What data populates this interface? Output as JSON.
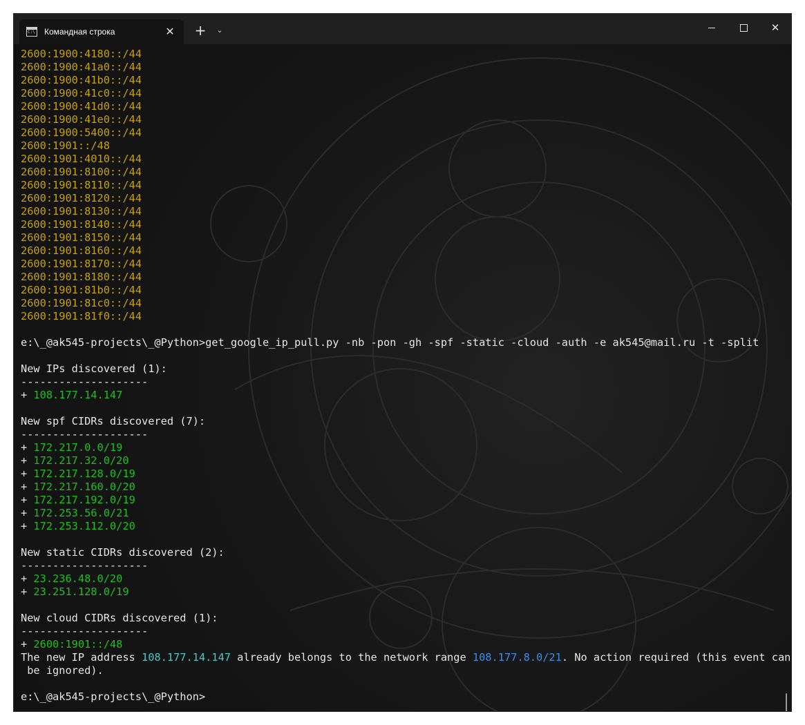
{
  "window": {
    "tab_title": "Командная строка",
    "tab_icon": "cmd-icon",
    "buttons": {
      "close_tab": "✕",
      "new_tab": "+",
      "dropdown": "⌄",
      "minimize": "minimize-icon",
      "maximize": "maximize-icon",
      "close": "✕"
    }
  },
  "colors": {
    "background": "#131313",
    "titlebar": "#202020",
    "yellow": "#c8a200",
    "green": "#19c419",
    "cyan": "#4cc7c7",
    "blue": "#3b8eea",
    "text": "#e6e6e6"
  },
  "terminal": {
    "yellow_cidrs": [
      "2600:1900:4180::/44",
      "2600:1900:41a0::/44",
      "2600:1900:41b0::/44",
      "2600:1900:41c0::/44",
      "2600:1900:41d0::/44",
      "2600:1900:41e0::/44",
      "2600:1900:5400::/44",
      "2600:1901::/48",
      "2600:1901:4010::/44",
      "2600:1901:8100::/44",
      "2600:1901:8110::/44",
      "2600:1901:8120::/44",
      "2600:1901:8130::/44",
      "2600:1901:8140::/44",
      "2600:1901:8150::/44",
      "2600:1901:8160::/44",
      "2600:1901:8170::/44",
      "2600:1901:8180::/44",
      "2600:1901:81b0::/44",
      "2600:1901:81c0::/44",
      "2600:1901:81f0::/44"
    ],
    "command": "e:\\_@ak545-projects\\_@Python>get_google_ip_pull.py -nb -pon -gh -spf -static -cloud -auth -e ak545@mail.ru -t -split",
    "separator": "--------------------",
    "plus": "+ ",
    "sections": [
      {
        "header": "New IPs discovered (1):",
        "items": [
          "108.177.14.147"
        ]
      },
      {
        "header": "New spf CIDRs discovered (7):",
        "items": [
          "172.217.0.0/19",
          "172.217.32.0/20",
          "172.217.128.0/19",
          "172.217.160.0/20",
          "172.217.192.0/19",
          "172.253.56.0/21",
          "172.253.112.0/20"
        ]
      },
      {
        "header": "New static CIDRs discovered (2):",
        "items": [
          "23.236.48.0/20",
          "23.251.128.0/19"
        ]
      },
      {
        "header": "New cloud CIDRs discovered (1):",
        "items": [
          "2600:1901::/48"
        ]
      }
    ],
    "message": {
      "part1": "The new IP address ",
      "ip": "108.177.14.147",
      "part2": " already belongs to the network range ",
      "range": "108.177.8.0/21",
      "part3": ". No action required (this event can",
      "part4": " be ignored)."
    },
    "prompt": "e:\\_@ak545-projects\\_@Python>"
  }
}
